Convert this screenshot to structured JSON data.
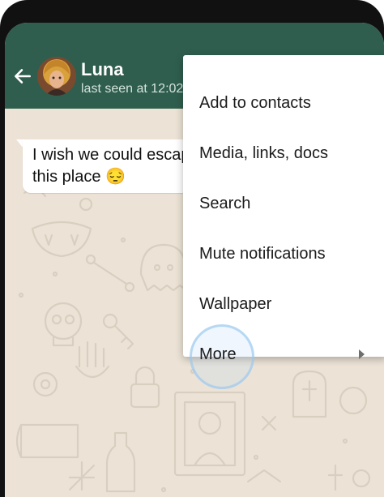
{
  "header": {
    "contact_name": "Luna",
    "last_seen": "last seen at 12:02",
    "background_color": "#2f5e4e"
  },
  "icons": {
    "back": "arrow-left-icon",
    "avatar": "avatar-image",
    "submenu": "chevron-right-icon"
  },
  "chat": {
    "messages": [
      {
        "line1": "I wish we could escape",
        "line2": "this place 😔"
      }
    ],
    "wallpaper": "halloween doodle pattern"
  },
  "menu": {
    "items": [
      {
        "label": "Add to contacts"
      },
      {
        "label": "Media, links, docs"
      },
      {
        "label": "Search"
      },
      {
        "label": "Mute notifications"
      },
      {
        "label": "Wallpaper"
      },
      {
        "label": "More"
      }
    ]
  }
}
